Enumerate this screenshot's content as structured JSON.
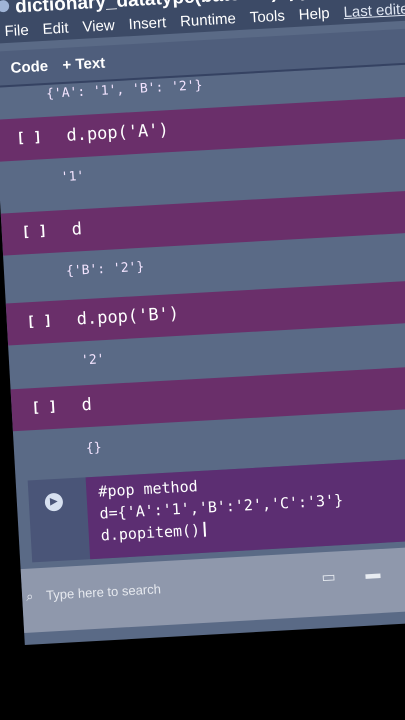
{
  "window": {
    "title": "dictionary_datatype(batch-D).ipynb",
    "star": "☆"
  },
  "menu": {
    "items": [
      "File",
      "Edit",
      "View",
      "Insert",
      "Runtime",
      "Tools",
      "Help"
    ],
    "last_edited": "Last edited o"
  },
  "toolbar": {
    "code_label": "Code",
    "text_label": "+ Text"
  },
  "cells": [
    {
      "output": "{'A': '1', 'B': '2'}"
    },
    {
      "bracket": "[ ]",
      "code": "d.pop('A')",
      "output": "'1'"
    },
    {
      "bracket": "[ ]",
      "code": "d",
      "output": "{'B': '2'}"
    },
    {
      "bracket": "[ ]",
      "code": "d.pop('B')",
      "output": "'2'"
    },
    {
      "bracket": "[ ]",
      "code": "d",
      "output": "{}"
    }
  ],
  "active_cell": {
    "lines": [
      "#pop method",
      "d={'A':'1','B':'2','C':'3'}",
      "d.popitem()"
    ]
  },
  "taskbar": {
    "search_placeholder": "Type here to search"
  }
}
